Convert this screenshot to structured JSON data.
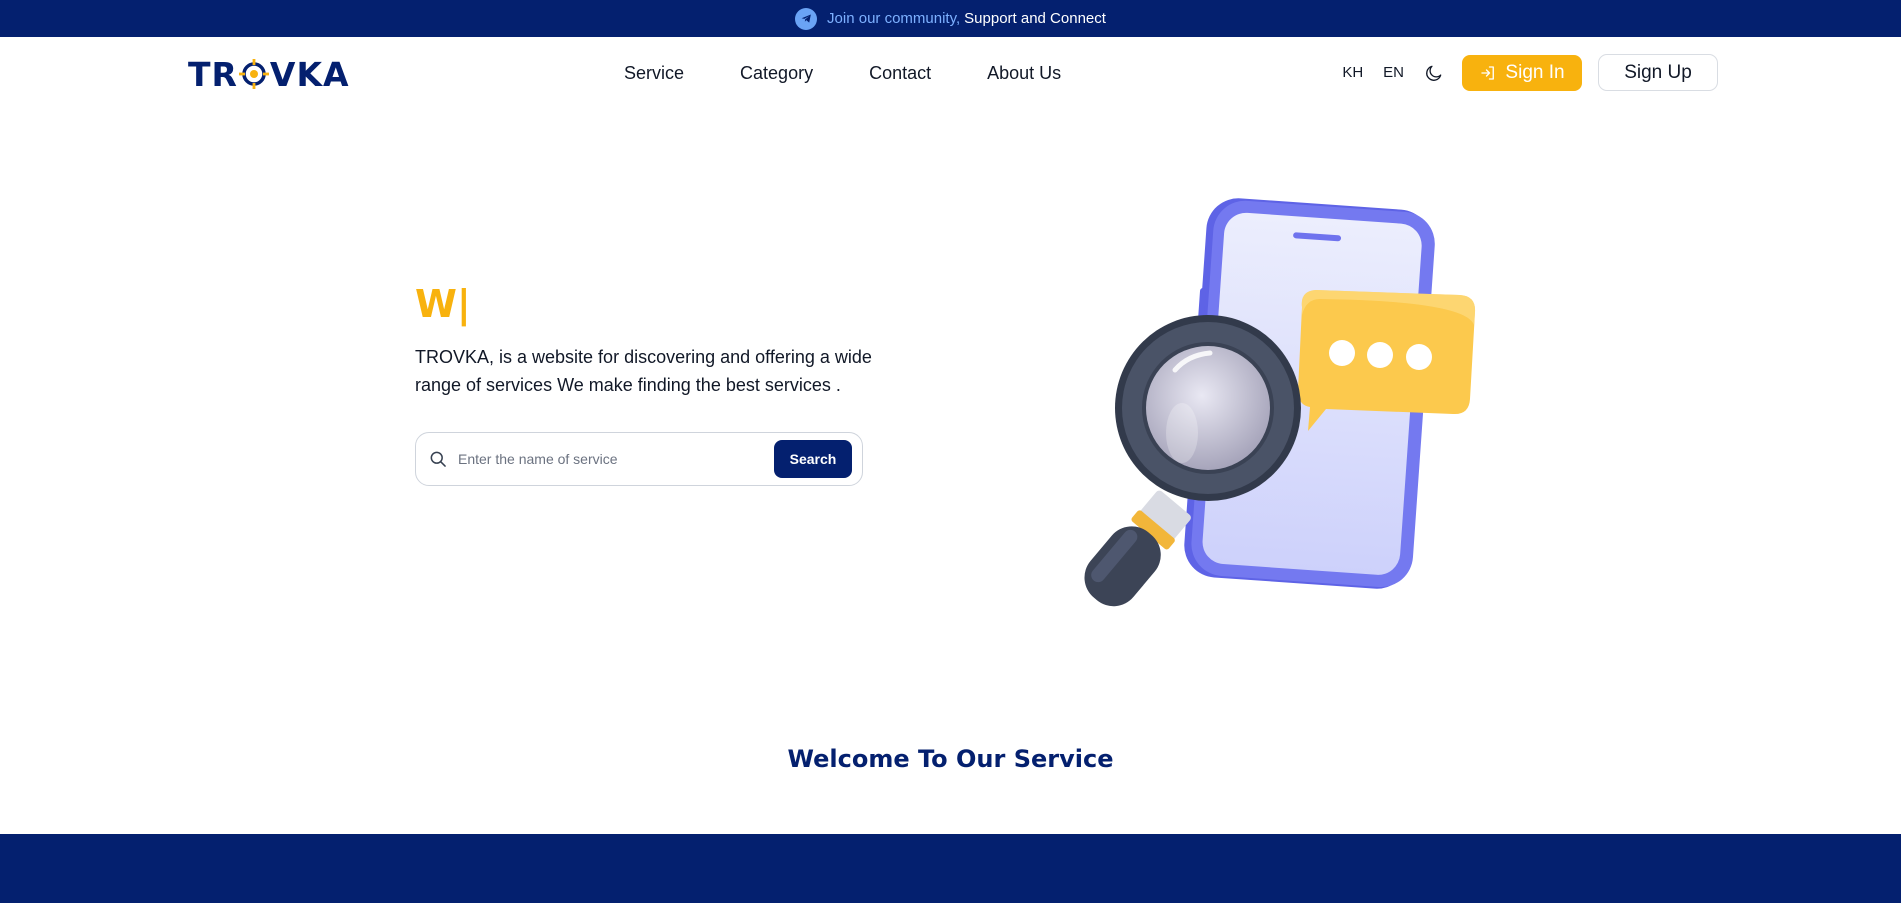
{
  "topbar": {
    "icon": "telegram-icon",
    "highlight_text": "Join our community,",
    "text": "Support and Connect"
  },
  "header": {
    "logo_text_left": "TR",
    "logo_text_right": "VKA",
    "nav": [
      {
        "label": "Service"
      },
      {
        "label": "Category"
      },
      {
        "label": "Contact"
      },
      {
        "label": "About Us"
      }
    ],
    "lang_kh": "KH",
    "lang_en": "EN",
    "theme_icon": "moon-icon",
    "signin_label": "Sign In",
    "signup_label": "Sign Up"
  },
  "hero": {
    "title": "W|",
    "description": "TROVKA, is a website for discovering and offering a wide range of services We make finding the best services .",
    "search_placeholder": "Enter the name of service",
    "search_button": "Search"
  },
  "welcome_title": "Welcome To Our Service",
  "colors": {
    "navy": "#04206f",
    "accent": "#f8b20e",
    "phone": "#6f73ee",
    "bubble": "#fcc94d"
  }
}
